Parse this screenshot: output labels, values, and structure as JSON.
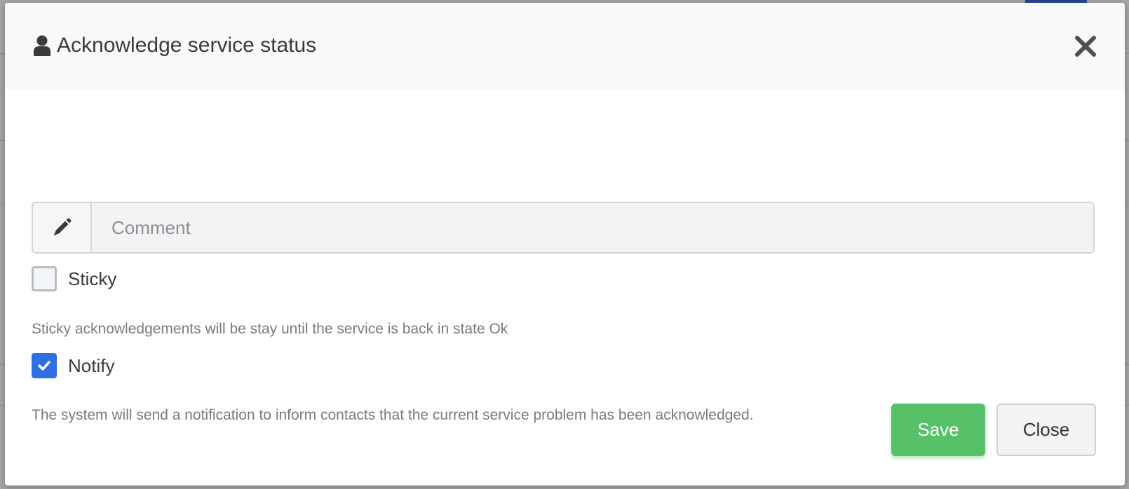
{
  "modal": {
    "title": "Acknowledge service status",
    "title_icon": "user-icon",
    "close_icon": "close-icon"
  },
  "comment": {
    "icon": "pencil-icon",
    "placeholder": "Comment",
    "value": ""
  },
  "sticky": {
    "label": "Sticky",
    "checked": false,
    "help": "Sticky acknowledgements will be stay until the service is back in state Ok"
  },
  "notify": {
    "label": "Notify",
    "checked": true,
    "help": "The system will send a notification to inform contacts that the current service problem has been acknowledged."
  },
  "buttons": {
    "save": "Save",
    "close": "Close"
  },
  "colors": {
    "save": "#56c168",
    "checkbox_checked": "#2f6fe0",
    "header_bg": "#f8f9fa"
  }
}
